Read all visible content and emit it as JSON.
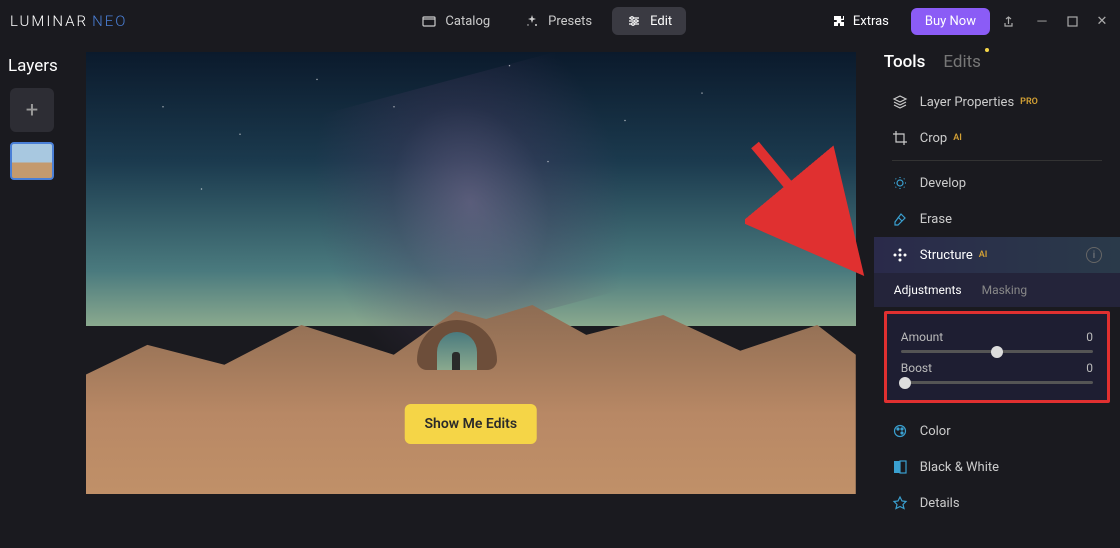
{
  "app": {
    "name_part1": "LUMINAR",
    "name_part2": "NEO"
  },
  "topTabs": {
    "catalog": "Catalog",
    "presets": "Presets",
    "edit": "Edit"
  },
  "header": {
    "extras": "Extras",
    "buyNow": "Buy Now"
  },
  "layers": {
    "title": "Layers"
  },
  "canvas": {
    "showEdits": "Show Me Edits"
  },
  "rightPanel": {
    "tabs": {
      "tools": "Tools",
      "edits": "Edits"
    },
    "tools": {
      "layerProperties": {
        "label": "Layer Properties",
        "badge": "PRO"
      },
      "crop": {
        "label": "Crop",
        "badge": "AI"
      },
      "develop": {
        "label": "Develop"
      },
      "erase": {
        "label": "Erase"
      },
      "structure": {
        "label": "Structure",
        "badge": "AI"
      },
      "color": {
        "label": "Color"
      },
      "blackWhite": {
        "label": "Black & White"
      },
      "details": {
        "label": "Details"
      }
    },
    "structurePanel": {
      "subtabs": {
        "adjustments": "Adjustments",
        "masking": "Masking"
      },
      "amountLabel": "Amount",
      "amountValue": "0",
      "boostLabel": "Boost",
      "boostValue": "0"
    }
  }
}
